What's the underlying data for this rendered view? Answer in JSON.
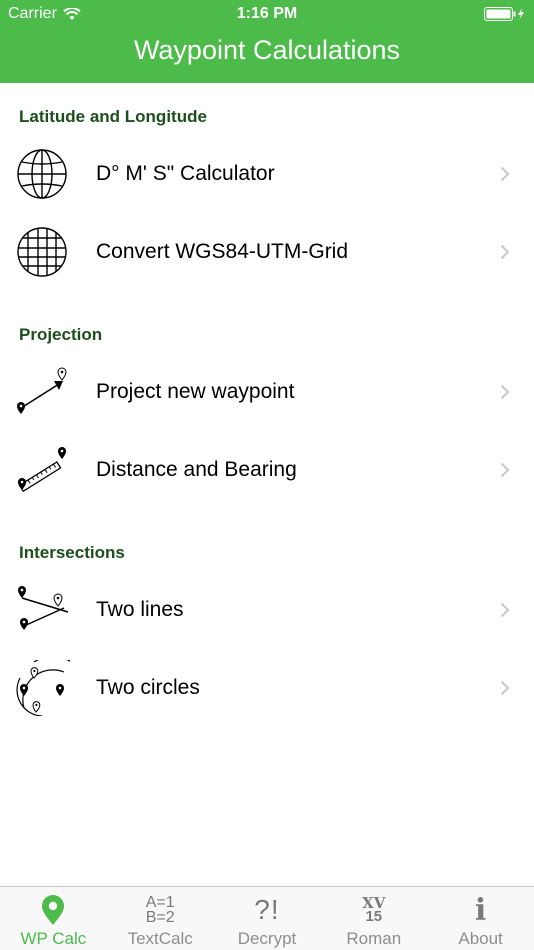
{
  "status_bar": {
    "carrier": "Carrier",
    "time": "1:16 PM"
  },
  "header": {
    "title": "Waypoint Calculations"
  },
  "sections": [
    {
      "title": "Latitude and Longitude",
      "items": [
        {
          "label": "D° M' S\" Calculator",
          "icon": "globe-icon"
        },
        {
          "label": "Convert WGS84-UTM-Grid",
          "icon": "grid-globe-icon"
        }
      ]
    },
    {
      "title": "Projection",
      "items": [
        {
          "label": "Project new waypoint",
          "icon": "project-waypoint-icon"
        },
        {
          "label": "Distance and Bearing",
          "icon": "distance-ruler-icon"
        }
      ]
    },
    {
      "title": "Intersections",
      "items": [
        {
          "label": "Two lines",
          "icon": "two-lines-icon"
        },
        {
          "label": "Two circles",
          "icon": "two-circles-icon"
        }
      ]
    }
  ],
  "tabs": [
    {
      "label": "WP Calc",
      "icon": "location-pin-icon",
      "active": true
    },
    {
      "label": "TextCalc",
      "icon_text": [
        "A=1",
        "B=2"
      ]
    },
    {
      "label": "Decrypt",
      "icon_text": "?!"
    },
    {
      "label": "Roman",
      "icon_text": [
        "XV",
        "15"
      ]
    },
    {
      "label": "About",
      "icon_text": "i"
    }
  ],
  "colors": {
    "accent": "#4cbb4a",
    "section_title": "#1d4f1d",
    "tab_inactive": "#8e8e8e"
  }
}
